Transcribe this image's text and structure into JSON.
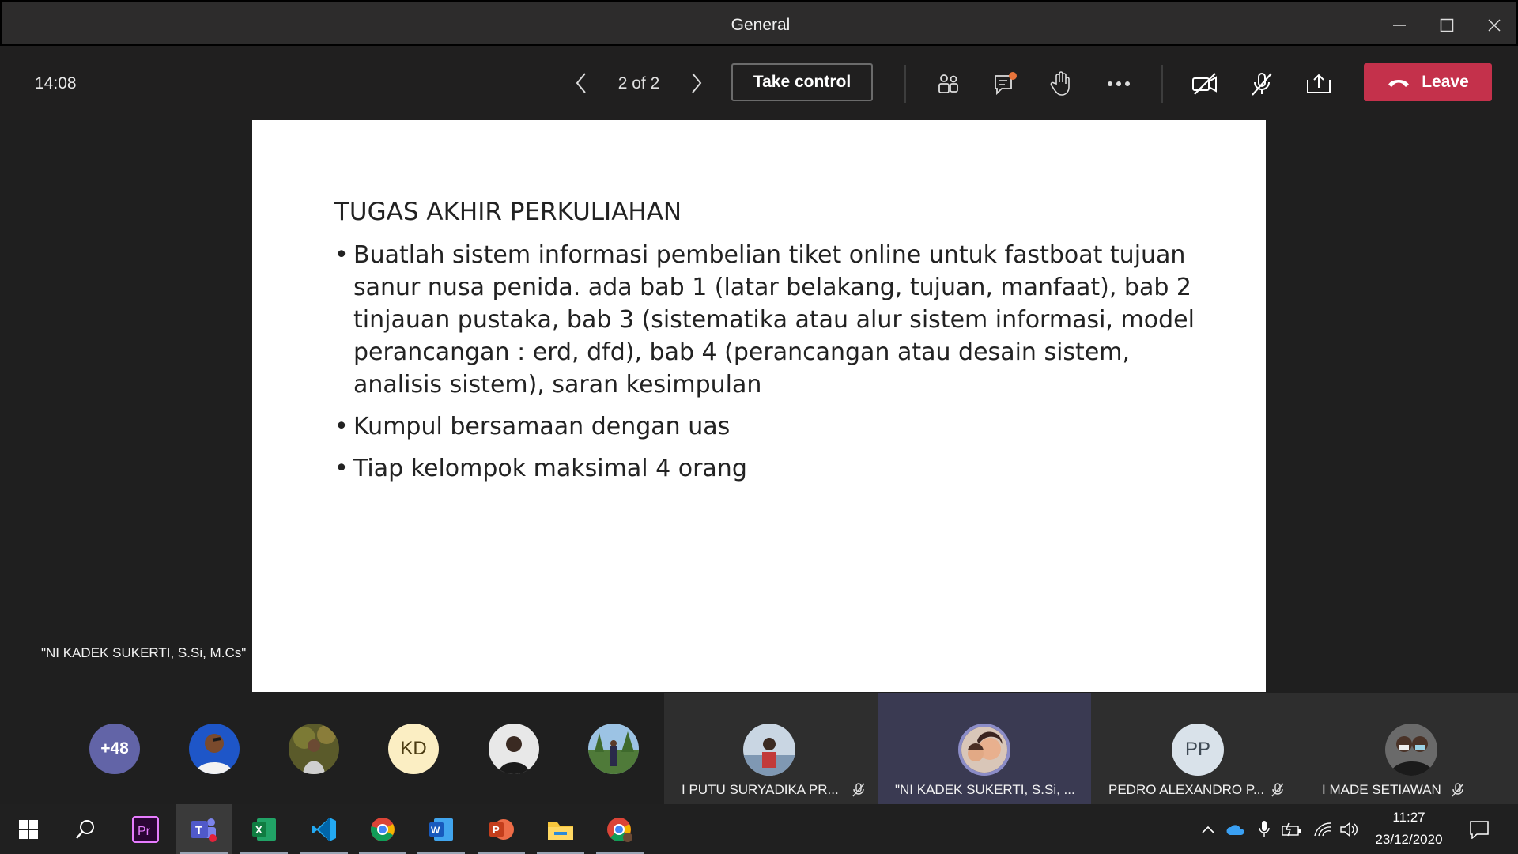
{
  "window": {
    "title": "General"
  },
  "toolbar": {
    "clock": "14:08",
    "pager": "2 of 2",
    "take_control_label": "Take control",
    "leave_label": "Leave"
  },
  "slide": {
    "title": "TUGAS AKHIR PERKULIAHAN",
    "bullets": [
      "Buatlah sistem informasi pembelian tiket online untuk fastboat tujuan sanur nusa penida. ada bab 1 (latar belakang, tujuan, manfaat), bab 2 tinjauan pustaka, bab 3 (sistematika atau alur sistem informasi, model perancangan : erd, dfd), bab 4 (perancangan atau desain sistem, analisis sistem), saran kesimpulan",
      "Kumpul bersamaan dengan uas",
      "Tiap kelompok maksimal 4 orang"
    ]
  },
  "presenter_label": "\"NI KADEK SUKERTI, S.Si, M.Cs\"",
  "participants": {
    "overflow_count": "+48",
    "initials_kd": "KD",
    "tiles": [
      {
        "name": "I PUTU SURYADIKA PR...",
        "muted": true
      },
      {
        "name": "\"NI KADEK SUKERTI, S.Si, ...",
        "muted": false,
        "active": true
      },
      {
        "name": "PEDRO ALEXANDRO P...",
        "initials": "PP",
        "muted": true
      },
      {
        "name": "I MADE SETIAWAN",
        "muted": true
      }
    ]
  },
  "taskbar": {
    "apps": [
      "start",
      "search",
      "premiere",
      "teams",
      "excel",
      "vscode",
      "chrome",
      "word",
      "powerpoint",
      "file-explorer",
      "chrome-profile"
    ],
    "time": "11:27",
    "date": "23/12/2020"
  },
  "colors": {
    "leave": "#c4314b",
    "accent": "#6264a7",
    "taskbar": "#202020"
  }
}
